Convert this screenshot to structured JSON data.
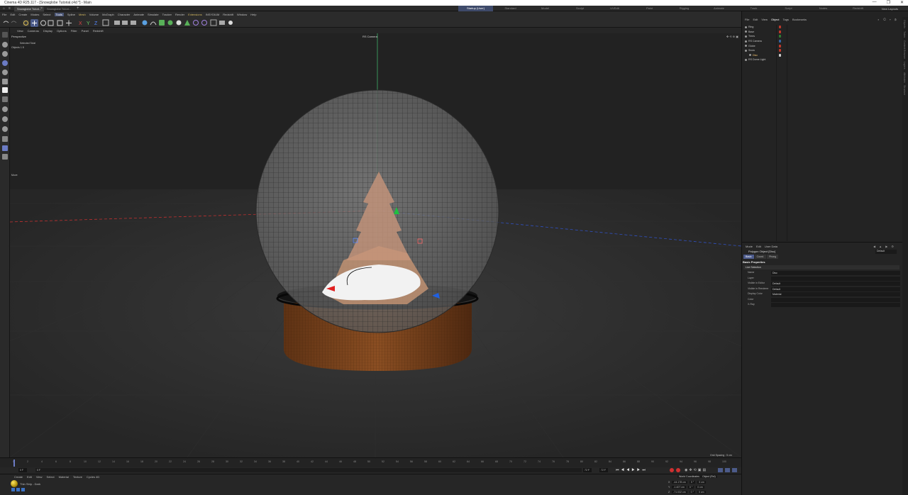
{
  "window": {
    "title": "Cinema 4D R25.117 - [Snowglobe Tutorial.c4d *] - Main",
    "controls": [
      "—",
      "❐",
      "✕"
    ]
  },
  "tabs": {
    "active": "Snowglobe Tutori...",
    "inactive": "Snowglobe Tutori..."
  },
  "layouts": [
    "Startup (User)",
    "Standard",
    "Model",
    "Sculpt",
    "UVEdit",
    "Paint",
    "Rigging",
    "Animate",
    "Track",
    "Script",
    "Nodes",
    "Redshift"
  ],
  "new_layouts": "New Layouts",
  "menubar": [
    "File",
    "Edit",
    "Create",
    "Modes",
    "Select",
    "Tools",
    "Spline",
    "Mesh",
    "Volume",
    "MoGraph",
    "Character",
    "Animate",
    "Simulate",
    "Tracker",
    "Render",
    "Extensions",
    "INSYDIUM",
    "Redshift",
    "Window",
    "Help"
  ],
  "viewport_menu": [
    "View",
    "Cameras",
    "Display",
    "Options",
    "Filter",
    "Panel",
    "Redshift"
  ],
  "viewport": {
    "label": "Perspective",
    "camera": "RS Camera",
    "stats_header": "Selected  Total",
    "stats_row": "Objects   1   8",
    "move_label": "Move",
    "grid_spacing": "Grid Spacing : 5 cm"
  },
  "timeline": {
    "frames": [
      "0",
      "2",
      "4",
      "6",
      "8",
      "10",
      "12",
      "14",
      "16",
      "18",
      "20",
      "22",
      "24",
      "26",
      "28",
      "30",
      "32",
      "34",
      "36",
      "38",
      "40",
      "42",
      "44",
      "46",
      "48",
      "50",
      "52",
      "54",
      "56",
      "58",
      "60",
      "62",
      "64",
      "66",
      "68",
      "70",
      "72",
      "74",
      "76",
      "78",
      "80",
      "82",
      "84",
      "86",
      "88",
      "90",
      "92",
      "94",
      "96",
      "98",
      "100"
    ],
    "start": "0 F",
    "start2": "0 F",
    "end": "72 F",
    "end2": "72 F",
    "current": "0 F"
  },
  "material": {
    "menu": [
      "Create",
      "Edit",
      "View",
      "Select",
      "Material",
      "Texture",
      "Cycles 4D"
    ],
    "name": "Thin Strip - Dark"
  },
  "coordinates": {
    "header_a": "World Coordinates",
    "header_b": "Object (Rel)",
    "rows": [
      {
        "axis": "X",
        "pos": "-44.178 cm",
        "rot": "0 °",
        "scale": "0 cm"
      },
      {
        "axis": "Y",
        "pos": "-1.407 cm",
        "rot": "0 °",
        "scale": "0 cm"
      },
      {
        "axis": "Z",
        "pos": "-71.032 cm",
        "rot": "0 °",
        "scale": "0 cm"
      }
    ]
  },
  "object_manager": {
    "menu": [
      "File",
      "Edit",
      "View",
      "Object",
      "Tags",
      "Bookmarks"
    ],
    "objects": [
      {
        "name": "Ring",
        "selected": false,
        "tag": "#c0392b"
      },
      {
        "name": "Base",
        "selected": false,
        "tag": "#c0392b"
      },
      {
        "name": "Trees",
        "selected": false,
        "tag": "#2e7d32"
      },
      {
        "name": "RS Camera",
        "selected": false,
        "tag": "#3465a4"
      },
      {
        "name": "Globe",
        "selected": false,
        "tag": "#c0392b"
      },
      {
        "name": "Snow",
        "selected": false,
        "tag": "#c0392b"
      },
      {
        "name": "Disc",
        "selected": true,
        "tag": "#cccccc"
      },
      {
        "name": "RS Dome Light",
        "selected": false,
        "tag": ""
      }
    ]
  },
  "attributes": {
    "menu": [
      "Mode",
      "Edit",
      "User Data"
    ],
    "title": "Polygon Object [Disc]",
    "mode_select": "Default",
    "tabs": [
      "Basic",
      "Coord.",
      "Phong"
    ],
    "active_tab": "Basic",
    "section": "Basic Properties",
    "group": "Live Selection",
    "rows": [
      {
        "label": "Name",
        "value": "Disc"
      },
      {
        "label": "Layer",
        "value": ""
      },
      {
        "label": "Visible in Editor",
        "value": "Default"
      },
      {
        "label": "Visible in Renderer",
        "value": "Default"
      },
      {
        "label": "Display Color",
        "value": "Material"
      },
      {
        "label": "Color",
        "value": ""
      },
      {
        "label": "X-Ray",
        "value": ""
      }
    ]
  },
  "side_tabs": [
    "Objects",
    "Takes",
    "Content Browser",
    "Layers",
    "Attributes",
    "Structure"
  ],
  "colors": {
    "accent": "#4c5b8a",
    "background": "#1e1e1e",
    "wood": "#7a4521",
    "globe": "#6e6e6e"
  }
}
